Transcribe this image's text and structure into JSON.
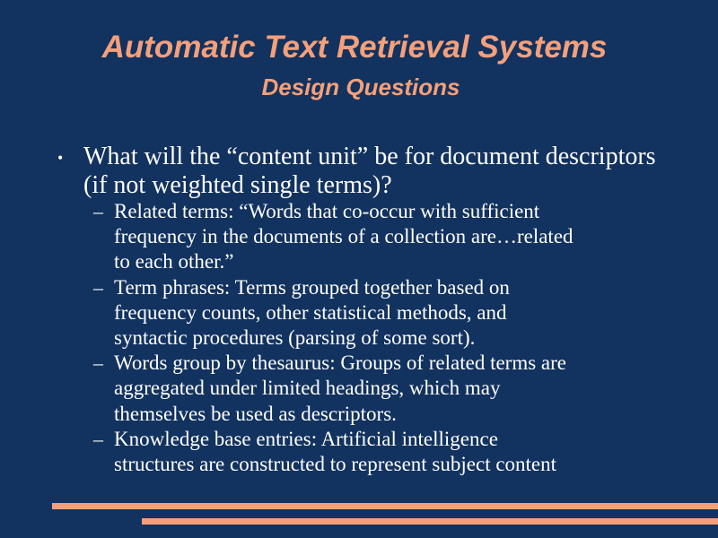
{
  "slide": {
    "title": "Automatic Text Retrieval Systems",
    "subtitle": "Design Questions",
    "bullet": {
      "symbol": "•",
      "text": "What will the “content unit” be for document descriptors (if not weighted single terms)?"
    },
    "sub_bullets": [
      {
        "symbol": "–",
        "text": "Related terms: “Words that co-occur with sufficient\nfrequency in the documents of a collection are…related\nto each other.”"
      },
      {
        "symbol": "–",
        "text": "Term phrases: Terms grouped together based on\nfrequency counts, other statistical methods, and\nsyntactic procedures (parsing of some sort)."
      },
      {
        "symbol": "–",
        "text": "Words group by thesaurus: Groups of related terms are\naggregated under limited headings, which may\nthemselves be used as descriptors."
      },
      {
        "symbol": "–",
        "text": "Knowledge base entries: Artificial intelligence\nstructures are constructed to represent subject content"
      }
    ]
  },
  "colors": {
    "background": "#12325f",
    "accent": "#f5a07a",
    "text": "#ffffff"
  }
}
